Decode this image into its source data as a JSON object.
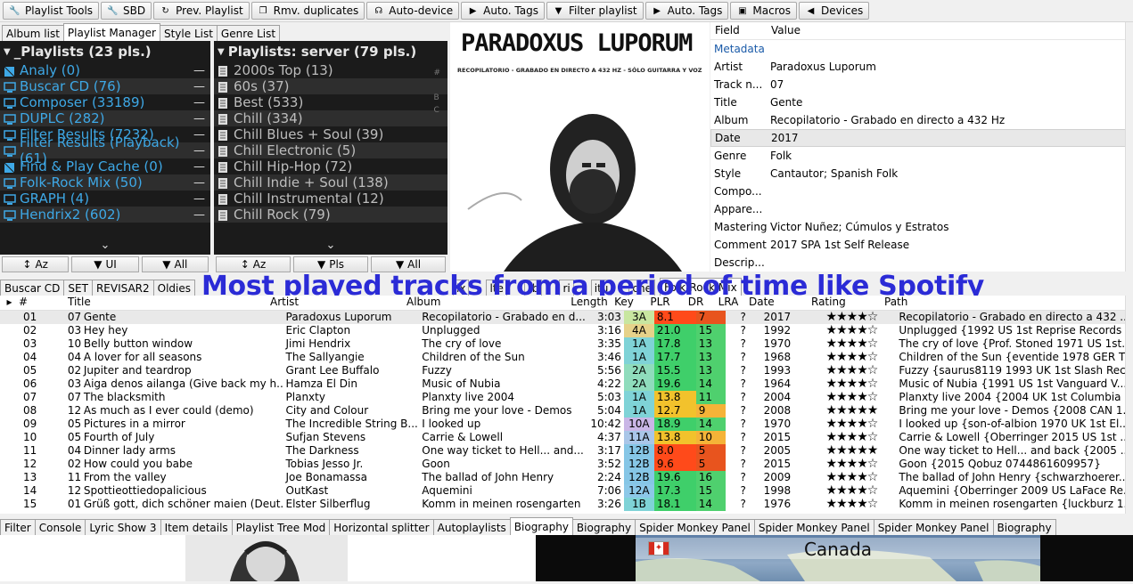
{
  "toolbar": [
    {
      "label": "Playlist Tools",
      "icon": "wrench-icon"
    },
    {
      "label": "SBD",
      "icon": "wrench-icon"
    },
    {
      "label": "Prev. Playlist",
      "icon": "refresh-icon"
    },
    {
      "label": "Rmv. duplicates",
      "icon": "copy-icon"
    },
    {
      "label": "Auto-device",
      "icon": "headphones-icon"
    },
    {
      "label": "Auto. Tags",
      "icon": "tag-icon"
    },
    {
      "label": "Filter playlist",
      "icon": "funnel-icon"
    },
    {
      "label": "Auto. Tags",
      "icon": "tag-icon"
    },
    {
      "label": "Macros",
      "icon": "film-icon"
    },
    {
      "label": "Devices",
      "icon": "speaker-icon"
    }
  ],
  "top_tabs": [
    "Album list",
    "Playlist Manager",
    "Style List",
    "Genre List"
  ],
  "left_panel": {
    "title": "_Playlists (23 pls.)",
    "items": [
      {
        "label": "Analy (0)",
        "icon": "autoplaylist-icon"
      },
      {
        "label": "Buscar CD (76)",
        "icon": "monitor-icon"
      },
      {
        "label": "Composer (33189)",
        "icon": "monitor-icon"
      },
      {
        "label": "DUPLC (282)",
        "icon": "monitor-icon"
      },
      {
        "label": "Filter Results (7232)",
        "icon": "monitor-icon"
      },
      {
        "label": "Filter Results (Playback) (61)",
        "icon": "monitor-icon"
      },
      {
        "label": "Find & Play Cache (0)",
        "icon": "autoplaylist-icon"
      },
      {
        "label": "Folk-Rock Mix (50)",
        "icon": "monitor-icon"
      },
      {
        "label": "GRAPH (4)",
        "icon": "monitor-icon"
      },
      {
        "label": "Hendrix2 (602)",
        "icon": "monitor-icon"
      }
    ],
    "buttons": [
      {
        "label": "Az",
        "icon": "sort-icon"
      },
      {
        "label": "UI",
        "icon": "funnel-icon"
      },
      {
        "label": "All",
        "icon": "funnel-icon"
      }
    ]
  },
  "right_panel": {
    "title": "Playlists: server (79 pls.)",
    "items": [
      "2000s Top (13)",
      "60s (37)",
      "Best (533)",
      "Chill (334)",
      "Chill Blues + Soul (39)",
      "Chill Electronic (5)",
      "Chill Hip-Hop (72)",
      "Chill Indie + Soul (138)",
      "Chill Instrumental (12)",
      "Chill Rock (79)"
    ],
    "index_letters": [
      "#",
      "B",
      "C"
    ],
    "buttons": [
      {
        "label": "Az",
        "icon": "sort-icon"
      },
      {
        "label": "Pls",
        "icon": "funnel-icon"
      },
      {
        "label": "All",
        "icon": "funnel-icon"
      }
    ]
  },
  "cover": {
    "artist": "PARADOXUS LUPORUM",
    "subtitle": "RECOPILATORIO - GRABADO EN DIRECTO A 432 HZ - SÓLO GUITARRA Y VOZ"
  },
  "properties": {
    "header_field": "Field",
    "header_value": "Value",
    "section": "Metadata",
    "rows": [
      {
        "f": "Artist",
        "v": "Paradoxus Luporum"
      },
      {
        "f": "Track n...",
        "v": "07"
      },
      {
        "f": "Title",
        "v": "Gente"
      },
      {
        "f": "Album",
        "v": "Recopilatorio - Grabado en directo a 432 Hz"
      },
      {
        "f": "Date",
        "v": "2017"
      },
      {
        "f": "Genre",
        "v": "Folk"
      },
      {
        "f": "Style",
        "v": "Cantautor; Spanish Folk"
      },
      {
        "f": "Compo...",
        "v": ""
      },
      {
        "f": "Appare...",
        "v": ""
      },
      {
        "f": "Mastering",
        "v": "Victor Nuñez; Cúmulos y Estratos"
      },
      {
        "f": "Comment",
        "v": "2017 SPA 1st Self Release"
      },
      {
        "f": "Descrip...",
        "v": ""
      }
    ]
  },
  "mid_tabs": [
    "Buscar CD",
    "SET",
    "REVISAR2",
    "Oldies",
    "ix",
    "lte",
    "rb",
    "ri",
    "itu",
    "che",
    "Folk-Rock Mix"
  ],
  "overlay_text": "Most played tracks from a period of time like Spotify",
  "grid": {
    "headers": [
      "",
      "#",
      "Title",
      "Artist",
      "Album",
      "Length",
      "Key",
      "PLR",
      "DR",
      "LRA",
      "Date",
      "Rating",
      "Path"
    ],
    "rows": [
      {
        "n": "01",
        "t": "07",
        "title": "Gente",
        "artist": "Paradoxus Luporum",
        "album": "Recopilatorio - Grabado en d...",
        "len": "3:03",
        "key": "3A",
        "plr": "8.1",
        "dr": "7",
        "lra": "?",
        "date": "2017",
        "rating": 4,
        "path": "Recopilatorio - Grabado en directo a 432 ..."
      },
      {
        "n": "02",
        "t": "03",
        "title": "Hey hey",
        "artist": "Eric Clapton",
        "album": "Unplugged",
        "len": "3:16",
        "key": "4A",
        "plr": "21.0",
        "dr": "15",
        "lra": "?",
        "date": "1992",
        "rating": 4,
        "path": "Unplugged {1992 US 1st Reprise Records ..."
      },
      {
        "n": "03",
        "t": "10",
        "title": "Belly button window",
        "artist": "Jimi Hendrix",
        "album": "The cry of love",
        "len": "3:35",
        "key": "1A",
        "plr": "17.8",
        "dr": "13",
        "lra": "?",
        "date": "1970",
        "rating": 4,
        "path": "The cry of love {Prof. Stoned 1971 US 1st..."
      },
      {
        "n": "04",
        "t": "04",
        "title": "A lover for all seasons",
        "artist": "The Sallyangie",
        "album": "Children of the Sun",
        "len": "3:46",
        "key": "1A",
        "plr": "17.7",
        "dr": "13",
        "lra": "?",
        "date": "1968",
        "rating": 4,
        "path": "Children of the Sun {eventide 1978 GER T..."
      },
      {
        "n": "05",
        "t": "02",
        "title": "Jupiter and teardrop",
        "artist": "Grant Lee Buffalo",
        "album": "Fuzzy",
        "len": "5:56",
        "key": "2A",
        "plr": "15.5",
        "dr": "13",
        "lra": "?",
        "date": "1993",
        "rating": 4,
        "path": "Fuzzy {saurus8119 1993 UK 1st Slash Rec..."
      },
      {
        "n": "06",
        "t": "03",
        "title": "Aiga denos ailanga (Give back my h...",
        "artist": "Hamza El Din",
        "album": "Music of Nubia",
        "len": "4:22",
        "key": "2A",
        "plr": "19.6",
        "dr": "14",
        "lra": "?",
        "date": "1964",
        "rating": 4,
        "path": "Music of Nubia {1991 US 1st Vanguard V..."
      },
      {
        "n": "07",
        "t": "07",
        "title": "The blacksmith",
        "artist": "Planxty",
        "album": "Planxty live 2004",
        "len": "5:03",
        "key": "1A",
        "plr": "13.8",
        "dr": "11",
        "lra": "?",
        "date": "2004",
        "rating": 4,
        "path": "Planxty live 2004 {2004 UK 1st Columbia ..."
      },
      {
        "n": "08",
        "t": "12",
        "title": "As much as I ever could (demo)",
        "artist": "City and Colour",
        "album": "Bring me your love - Demos",
        "len": "5:04",
        "key": "1A",
        "plr": "12.7",
        "dr": "9",
        "lra": "?",
        "date": "2008",
        "rating": 5,
        "path": "Bring me your love - Demos {2008 CAN 1..."
      },
      {
        "n": "09",
        "t": "05",
        "title": "Pictures in a mirror",
        "artist": "The Incredible String B...",
        "album": "I looked up",
        "len": "10:42",
        "key": "10A",
        "plr": "18.9",
        "dr": "14",
        "lra": "?",
        "date": "1970",
        "rating": 4,
        "path": "I looked up {son-of-albion 1970 UK 1st El..."
      },
      {
        "n": "10",
        "t": "05",
        "title": "Fourth of July",
        "artist": "Sufjan Stevens",
        "album": "Carrie & Lowell",
        "len": "4:37",
        "key": "11A",
        "plr": "13.8",
        "dr": "10",
        "lra": "?",
        "date": "2015",
        "rating": 4,
        "path": "Carrie & Lowell {Oberringer 2015 US 1st ..."
      },
      {
        "n": "11",
        "t": "04",
        "title": "Dinner lady arms",
        "artist": "The Darkness",
        "album": "One way ticket to Hell... and...",
        "len": "3:17",
        "key": "12B",
        "plr": "8.0",
        "dr": "5",
        "lra": "?",
        "date": "2005",
        "rating": 5,
        "path": "One way ticket to Hell... and back {2005 ..."
      },
      {
        "n": "12",
        "t": "02",
        "title": "How could you babe",
        "artist": "Tobias Jesso Jr.",
        "album": "Goon",
        "len": "3:52",
        "key": "12B",
        "plr": "9.6",
        "dr": "5",
        "lra": "?",
        "date": "2015",
        "rating": 4,
        "path": "Goon {2015 Qobuz 0744861609957}"
      },
      {
        "n": "13",
        "t": "11",
        "title": "From the valley",
        "artist": "Joe Bonamassa",
        "album": "The ballad of John Henry",
        "len": "2:24",
        "key": "12B",
        "plr": "19.6",
        "dr": "16",
        "lra": "?",
        "date": "2009",
        "rating": 4,
        "path": "The ballad of John Henry {schwarzhoerer..."
      },
      {
        "n": "14",
        "t": "12",
        "title": "Spottieottiedopalicious",
        "artist": "OutKast",
        "album": "Aquemini",
        "len": "7:06",
        "key": "12A",
        "plr": "17.3",
        "dr": "15",
        "lra": "?",
        "date": "1998",
        "rating": 4,
        "path": "Aquemini {Oberringer 2009 US LaFace Re..."
      },
      {
        "n": "15",
        "t": "01",
        "title": "Grüß gott, dich schöner maien (Deut...",
        "artist": "Elster Silberflug",
        "album": "Komm in meinen rosengarten",
        "len": "3:26",
        "key": "1B",
        "plr": "18.1",
        "dr": "14",
        "lra": "?",
        "date": "1976",
        "rating": 4,
        "path": "Komm in meinen rosengarten {luckburz 1..."
      }
    ]
  },
  "bottom_tabs": [
    "Filter",
    "Console",
    "Lyric Show 3",
    "Item details",
    "Playlist Tree Mod",
    "Horizontal splitter",
    "Autoplaylists",
    "Biography",
    "Biography",
    "Spider Monkey Panel",
    "Spider Monkey Panel",
    "Spider Monkey Panel",
    "Biography"
  ],
  "map_label": "Canada",
  "colors": {
    "panel_bg": "#1b1b1b",
    "playlist_blue": "#3ea8e6",
    "overlay_blue": "#2b2bd6"
  }
}
